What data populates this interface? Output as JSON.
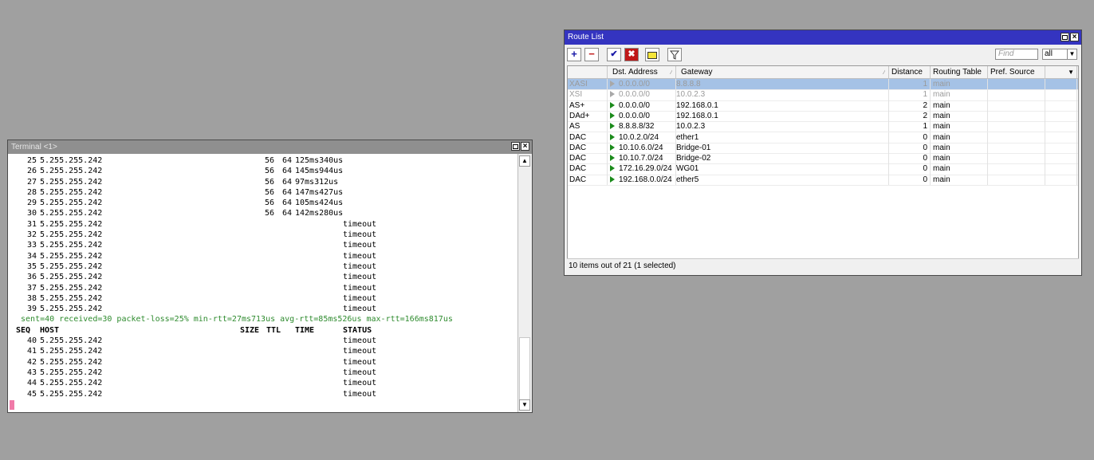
{
  "terminal": {
    "title": "Terminal <1>",
    "lines": [
      {
        "seq": "25",
        "host": "5.255.255.242",
        "size": "56",
        "ttl": "64",
        "time": "125ms340us",
        "status": ""
      },
      {
        "seq": "26",
        "host": "5.255.255.242",
        "size": "56",
        "ttl": "64",
        "time": "145ms944us",
        "status": ""
      },
      {
        "seq": "27",
        "host": "5.255.255.242",
        "size": "56",
        "ttl": "64",
        "time": "97ms312us",
        "status": ""
      },
      {
        "seq": "28",
        "host": "5.255.255.242",
        "size": "56",
        "ttl": "64",
        "time": "147ms427us",
        "status": ""
      },
      {
        "seq": "29",
        "host": "5.255.255.242",
        "size": "56",
        "ttl": "64",
        "time": "105ms424us",
        "status": ""
      },
      {
        "seq": "30",
        "host": "5.255.255.242",
        "size": "56",
        "ttl": "64",
        "time": "142ms280us",
        "status": ""
      },
      {
        "seq": "31",
        "host": "5.255.255.242",
        "size": "",
        "ttl": "",
        "time": "",
        "status": "timeout"
      },
      {
        "seq": "32",
        "host": "5.255.255.242",
        "size": "",
        "ttl": "",
        "time": "",
        "status": "timeout"
      },
      {
        "seq": "33",
        "host": "5.255.255.242",
        "size": "",
        "ttl": "",
        "time": "",
        "status": "timeout"
      },
      {
        "seq": "34",
        "host": "5.255.255.242",
        "size": "",
        "ttl": "",
        "time": "",
        "status": "timeout"
      },
      {
        "seq": "35",
        "host": "5.255.255.242",
        "size": "",
        "ttl": "",
        "time": "",
        "status": "timeout"
      },
      {
        "seq": "36",
        "host": "5.255.255.242",
        "size": "",
        "ttl": "",
        "time": "",
        "status": "timeout"
      },
      {
        "seq": "37",
        "host": "5.255.255.242",
        "size": "",
        "ttl": "",
        "time": "",
        "status": "timeout"
      },
      {
        "seq": "38",
        "host": "5.255.255.242",
        "size": "",
        "ttl": "",
        "time": "",
        "status": "timeout"
      },
      {
        "seq": "39",
        "host": "5.255.255.242",
        "size": "",
        "ttl": "",
        "time": "",
        "status": "timeout"
      }
    ],
    "summary": " sent=40 received=30 packet-loss=25% min-rtt=27ms713us avg-rtt=85ms526us max-rtt=166ms817us",
    "header": {
      "seq": "SEQ",
      "host": "HOST",
      "size": "SIZE",
      "ttl": "TTL",
      "time": "TIME",
      "status": "STATUS"
    },
    "lines2": [
      {
        "seq": "40",
        "host": "5.255.255.242",
        "status": "timeout"
      },
      {
        "seq": "41",
        "host": "5.255.255.242",
        "status": "timeout"
      },
      {
        "seq": "42",
        "host": "5.255.255.242",
        "status": "timeout"
      },
      {
        "seq": "43",
        "host": "5.255.255.242",
        "status": "timeout"
      },
      {
        "seq": "44",
        "host": "5.255.255.242",
        "status": "timeout"
      },
      {
        "seq": "45",
        "host": "5.255.255.242",
        "status": "timeout"
      }
    ],
    "cursor_color": "#f07aa8"
  },
  "route_list": {
    "title": "Route List",
    "toolbar": {
      "add_icon": "plus-icon",
      "remove_icon": "minus-icon",
      "enable_icon": "check-icon",
      "disable_icon": "x-icon",
      "comment_icon": "note-icon",
      "filter_icon": "filter-icon",
      "find_placeholder": "Find",
      "filter_select": "all"
    },
    "columns": [
      "",
      "Dst. Address",
      "Gateway",
      "Distance",
      "Routing Table",
      "Pref. Source"
    ],
    "rows": [
      {
        "flags": "XASI",
        "dst": "0.0.0.0/0",
        "gateway": "8.8.8.8",
        "distance": "1",
        "table": "main",
        "pref": "",
        "selected": true,
        "disabled": true
      },
      {
        "flags": "XSI",
        "dst": "0.0.0.0/0",
        "gateway": "10.0.2.3",
        "distance": "1",
        "table": "main",
        "pref": "",
        "selected": false,
        "disabled": true
      },
      {
        "flags": "AS+",
        "dst": "0.0.0.0/0",
        "gateway": "192.168.0.1",
        "distance": "2",
        "table": "main",
        "pref": "",
        "selected": false,
        "disabled": false
      },
      {
        "flags": "DAd+",
        "dst": "0.0.0.0/0",
        "gateway": "192.168.0.1",
        "distance": "2",
        "table": "main",
        "pref": "",
        "selected": false,
        "disabled": false
      },
      {
        "flags": "AS",
        "dst": "8.8.8.8/32",
        "gateway": "10.0.2.3",
        "distance": "1",
        "table": "main",
        "pref": "",
        "selected": false,
        "disabled": false
      },
      {
        "flags": "DAC",
        "dst": "10.0.2.0/24",
        "gateway": "ether1",
        "distance": "0",
        "table": "main",
        "pref": "",
        "selected": false,
        "disabled": false
      },
      {
        "flags": "DAC",
        "dst": "10.10.6.0/24",
        "gateway": "Bridge-01",
        "distance": "0",
        "table": "main",
        "pref": "",
        "selected": false,
        "disabled": false
      },
      {
        "flags": "DAC",
        "dst": "10.10.7.0/24",
        "gateway": "Bridge-02",
        "distance": "0",
        "table": "main",
        "pref": "",
        "selected": false,
        "disabled": false
      },
      {
        "flags": "DAC",
        "dst": "172.16.29.0/24",
        "gateway": "WG01",
        "distance": "0",
        "table": "main",
        "pref": "",
        "selected": false,
        "disabled": false
      },
      {
        "flags": "DAC",
        "dst": "192.168.0.0/24",
        "gateway": "ether5",
        "distance": "0",
        "table": "main",
        "pref": "",
        "selected": false,
        "disabled": false
      }
    ],
    "status": "10 items out of 21 (1 selected)",
    "colors": {
      "title_bar": "#3434c0",
      "selected_row": "#a5c2e6",
      "active_arrow": "#1a8a1a"
    }
  }
}
